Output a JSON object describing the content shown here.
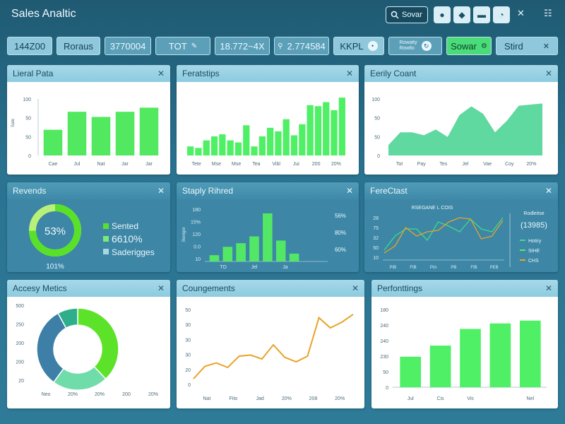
{
  "app": {
    "title": "Sales Analtic"
  },
  "toolbar": {
    "search_label": "Sovar",
    "icons": [
      "user-icon",
      "bell-icon",
      "mail-icon",
      "clock-icon"
    ],
    "menu_glyphs": [
      "x-icon",
      "grid-icon"
    ]
  },
  "kpis": [
    {
      "label": "144Z00"
    },
    {
      "label": "Roraus"
    },
    {
      "label": "3770004"
    },
    {
      "label": "TOT"
    },
    {
      "label": "18.772~4X"
    },
    {
      "label": "2.774584"
    },
    {
      "label": "KKPL"
    },
    {
      "label": "Rowatty",
      "sub": "Rowtlo"
    },
    {
      "label": "Sowar"
    },
    {
      "label": "Stird"
    }
  ],
  "colors": {
    "accent_green": "#4be36c",
    "bar_green": "#57ef6a",
    "teal_fill": "#5fd9a0",
    "line_orange": "#e8a32a"
  },
  "panels": {
    "p1": {
      "title": "Lieral Pata",
      "chart_data": {
        "type": "bar",
        "categories": [
          "Cae",
          "Jul",
          "Nat",
          "Jar",
          "Jar"
        ],
        "values": [
          50,
          85,
          75,
          85,
          93
        ],
        "y_ticks": [
          "100",
          "50",
          "50",
          "0"
        ],
        "ylabel": "Sale",
        "ylim": [
          0,
          110
        ]
      }
    },
    "p2": {
      "title": "Feratstips",
      "chart_data": {
        "type": "bar",
        "categories": [
          "Tete",
          "Mse",
          "Mse",
          "Tea",
          "Vibl",
          "Jui",
          "200",
          "20%"
        ],
        "values": [
          18,
          15,
          30,
          38,
          42,
          30,
          26,
          60,
          18,
          38,
          55,
          48,
          72,
          40,
          62,
          100,
          98,
          106,
          90,
          115
        ],
        "y_ticks": []
      }
    },
    "p3": {
      "title": "Eerily Coant",
      "chart_data": {
        "type": "area",
        "categories": [
          "Tot",
          "Pay",
          "Tes",
          "Jel",
          "Vae",
          "Coy",
          "20%"
        ],
        "values": [
          18,
          40,
          40,
          35,
          45,
          32,
          70,
          85,
          72,
          40,
          60,
          86,
          88,
          90
        ],
        "y_ticks": [
          "100",
          "50",
          "50",
          "0"
        ],
        "ylim": [
          0,
          110
        ]
      }
    },
    "p4": {
      "title": "Revends",
      "donut_value": "53%",
      "sub_value": "101%",
      "legend": [
        "Sented",
        "6610%",
        "Saderigges"
      ]
    },
    "p5": {
      "title": "Staply Rihred",
      "chart_data": {
        "type": "bar",
        "categories": [
          "TO",
          "Jel",
          "Ja"
        ],
        "values": [
          12,
          28,
          35,
          48,
          92,
          40,
          15
        ],
        "y_ticks": [
          "180",
          "15%",
          "120",
          "0.0",
          "10"
        ],
        "right_labels": [
          "56%",
          "80%",
          "60%"
        ],
        "ylabel": "Beniger"
      }
    },
    "p6": {
      "title": "FereCtast",
      "chart_data": {
        "type": "line",
        "title": "RSEGANE L COIS",
        "categories": [
          "PIB",
          "FIB",
          "PIA",
          "PB",
          "FIB",
          "PEB"
        ],
        "series": [
          {
            "name": "Hotiry",
            "values": [
              14,
              34,
              44,
              44,
              28,
              54,
              48,
              40,
              58,
              44,
              40,
              60
            ]
          },
          {
            "name": "CHS",
            "values": [
              10,
              20,
              46,
              34,
              40,
              42,
              54,
              60,
              58,
              30,
              34,
              56
            ]
          }
        ],
        "y_ticks": [
          "28",
          "75",
          "32",
          "50",
          "10"
        ],
        "side_title": "Rodleitse",
        "side_value": "(13985)",
        "legend_extra": "SIHE"
      }
    },
    "p7": {
      "title": "Accesy Metics",
      "chart_data": {
        "type": "pie",
        "values": [
          38,
          22,
          32,
          8
        ],
        "colors": [
          "#5de22a",
          "#6fdca9",
          "#3d7fa6",
          "#2fae8c"
        ],
        "y_ticks": [
          "500",
          "250",
          "200",
          "200",
          "20"
        ],
        "categories": [
          "Neo",
          "20%",
          "20%",
          "200",
          "20%"
        ]
      }
    },
    "p8": {
      "title": "Coungements",
      "chart_data": {
        "type": "line",
        "categories": [
          "Nat",
          "Fito",
          "Jad",
          "20%",
          "208",
          "20%"
        ],
        "values": [
          10,
          32,
          38,
          30,
          50,
          52,
          45,
          70,
          48,
          40,
          50,
          118,
          100,
          110,
          124
        ],
        "y_ticks": [
          "50",
          "30",
          "30",
          "30",
          "20",
          "0"
        ],
        "ylim": [
          0,
          140
        ]
      }
    },
    "p9": {
      "title": "Perfonttings",
      "chart_data": {
        "type": "bar",
        "categories": [
          "Jul",
          "Cis",
          "Vis",
          "",
          "Nel"
        ],
        "values": [
          55,
          75,
          105,
          115,
          120
        ],
        "y_ticks": [
          "180",
          "240",
          "240",
          "230",
          "50",
          "0"
        ],
        "ylim": [
          0,
          140
        ]
      }
    }
  }
}
